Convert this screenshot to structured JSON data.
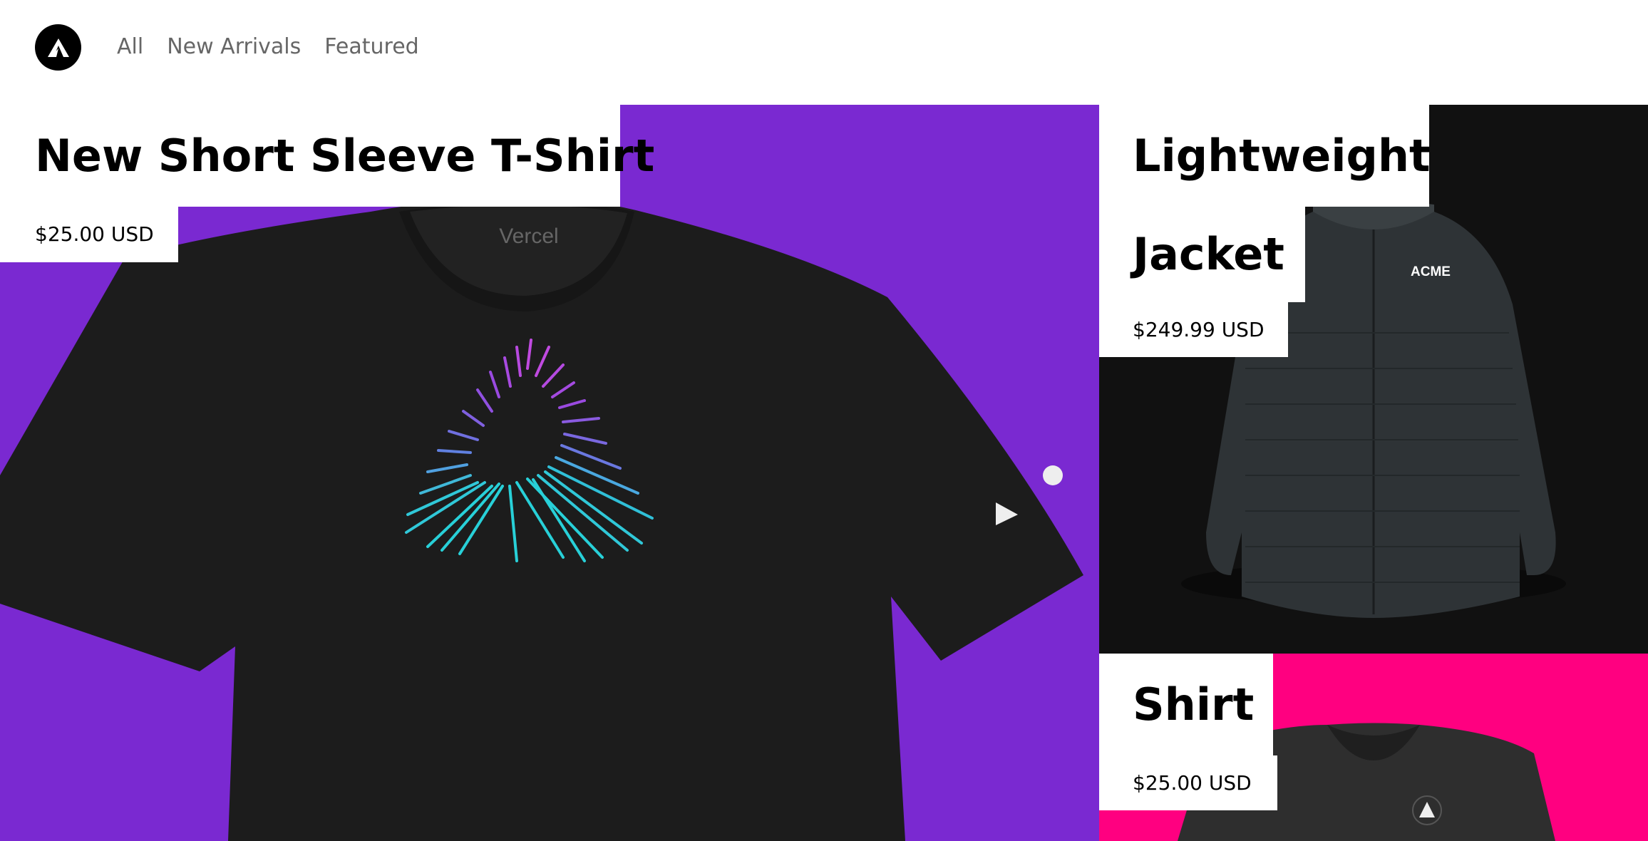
{
  "header": {
    "nav": [
      "All",
      "New Arrivals",
      "Featured"
    ],
    "logo_icon": "acme-triangle-logo-icon"
  },
  "products": {
    "tshirt": {
      "title": "New Short Sleeve T-Shirt",
      "price": "$25.00 USD",
      "collar_text": "Vercel"
    },
    "jacket": {
      "title_line1": "Lightweight",
      "title_line2": "Jacket",
      "price": "$249.99 USD",
      "brand_text": "ACME"
    },
    "shirt": {
      "title": "Shirt",
      "price": "$25.00 USD"
    }
  },
  "colors": {
    "tshirt_bg": "#7a29d1",
    "jacket_bg": "#111111",
    "shirt_bg": "#ff0080"
  }
}
